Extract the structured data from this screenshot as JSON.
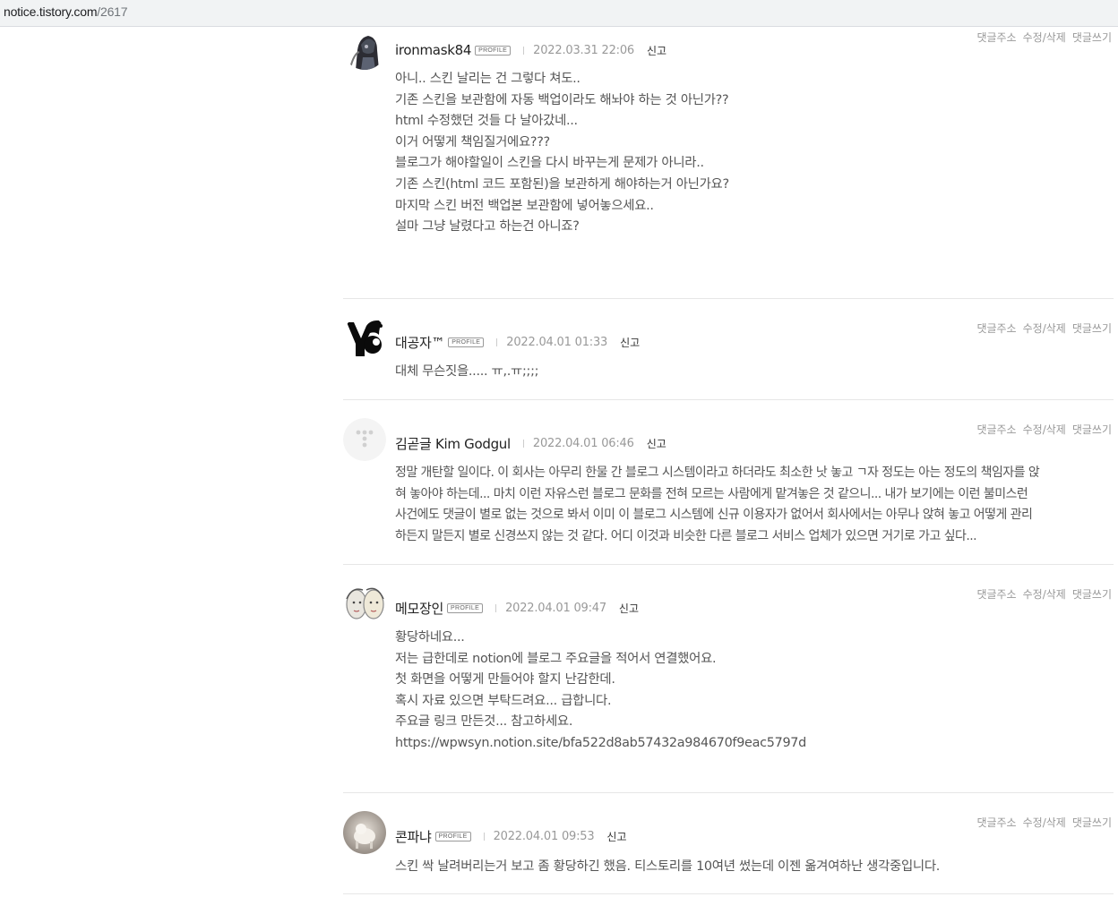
{
  "browser": {
    "url_host": "notice.tistory.com",
    "url_path": "/2617"
  },
  "actions": {
    "address": "댓글주소",
    "edit_delete": "수정/삭제",
    "reply": "댓글쓰기"
  },
  "labels": {
    "profile": "PROFILE",
    "report": "신고"
  },
  "comments": [
    {
      "author": "ironmask84",
      "has_profile": true,
      "date": "2022.03.31 22:06",
      "lines": [
        "아니.. 스킨 날리는 건 그렇다 쳐도..",
        "기존 스킨을 보관함에 자동 백업이라도 해놔야 하는 것 아닌가??",
        "html 수정했던 것들 다 날아갔네...",
        "이거 어떻게 책임질거에요???",
        "",
        "블로그가 해야할일이 스킨을 다시 바꾸는게 문제가 아니라..",
        "기존 스킨(html 코드 포함된)을 보관하게 해야하는거 아닌가요?",
        "",
        "마지막 스킨 버전 백업본 보관함에 넣어놓으세요..",
        "설마 그냥 날렸다고 하는건 아니죠?"
      ]
    },
    {
      "author": "대공자™",
      "has_profile": true,
      "date": "2022.04.01 01:33",
      "lines": [
        "대체 무슨짓을..... ㅠ,.ㅠ;;;;"
      ]
    },
    {
      "author": "김곧글 Kim Godgul",
      "has_profile": false,
      "date": "2022.04.01 06:46",
      "lines": [
        "정말 개탄할 일이다. 이 회사는 아무리 한물 간 블로그 시스템이라고 하더라도 최소한 낫 놓고 ㄱ자 정도는 아는 정도의 책임자를 앉",
        "혀 놓아야 하는데... 마치 이런 자유스런 블로그 문화를 전혀 모르는 사람에게 맡겨놓은 것 같으니... 내가 보기에는 이런 불미스런",
        "사건에도 댓글이 별로 없는 것으로 봐서 이미 이 블로그 시스템에 신규 이용자가 없어서 회사에서는 아무나 앉혀 놓고 어떻게 관리",
        "하든지 말든지 별로 신경쓰지 않는 것 같다. 어디 이것과 비슷한 다른 블로그 서비스 업체가 있으면 거기로 가고 싶다..."
      ]
    },
    {
      "author": "메모장인",
      "has_profile": true,
      "date": "2022.04.01 09:47",
      "lines": [
        "황당하네요...",
        "저는 급한데로 notion에 블로그 주요글을 적어서 연결했어요.",
        "첫 화면을 어떻게 만들어야 할지 난감한데.",
        "혹시 자료 있으면 부탁드려요... 급합니다.",
        "",
        "주요글 링크 만든것... 참고하세요.",
        "https://wpwsyn.notion.site/bfa522d8ab57432a984670f9eac5797d"
      ]
    },
    {
      "author": "콘파냐",
      "has_profile": true,
      "date": "2022.04.01 09:53",
      "lines": [
        "스킨 싹 날려버리는거 보고 좀 황당하긴 했음. 티스토리를 10여년 썼는데 이젠 옮겨여하난 생각중입니다."
      ]
    }
  ]
}
